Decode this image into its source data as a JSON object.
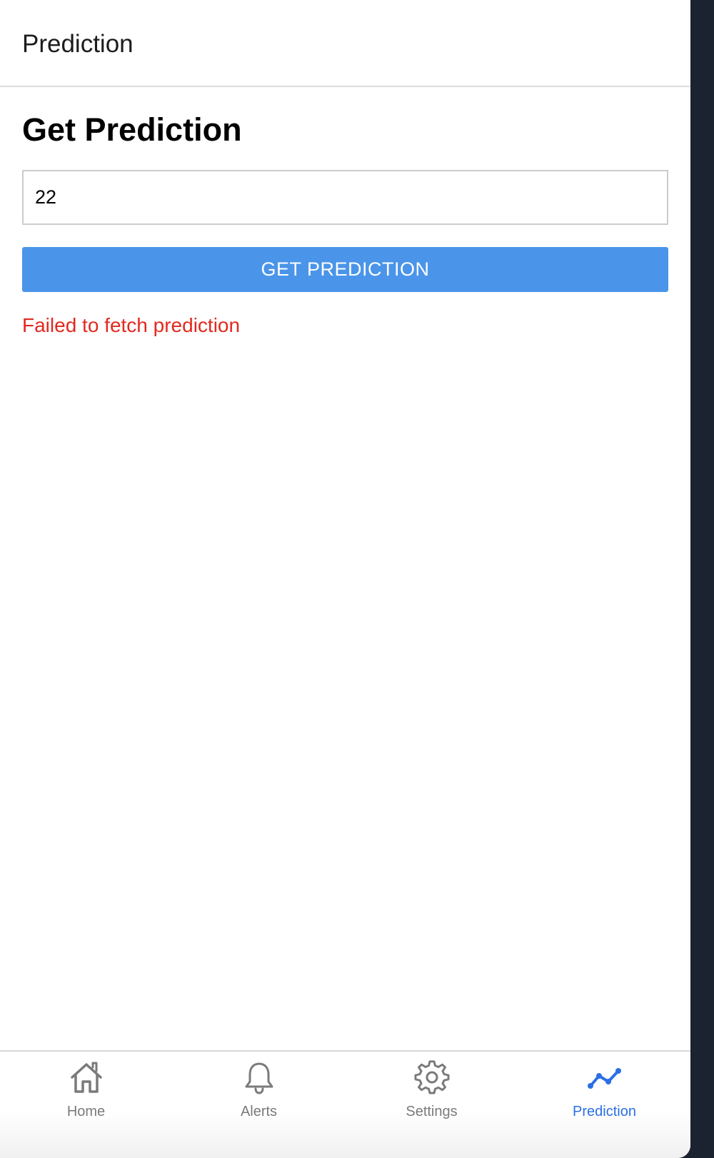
{
  "header": {
    "title": "Prediction"
  },
  "main": {
    "heading": "Get Prediction",
    "input_value": "22",
    "button_label": "GET PREDICTION",
    "error_message": "Failed to fetch prediction"
  },
  "tabbar": {
    "tabs": [
      {
        "label": "Home",
        "icon": "home-icon",
        "active": false
      },
      {
        "label": "Alerts",
        "icon": "bell-icon",
        "active": false
      },
      {
        "label": "Settings",
        "icon": "gear-icon",
        "active": false
      },
      {
        "label": "Prediction",
        "icon": "trend-line-icon",
        "active": true
      }
    ]
  },
  "colors": {
    "accent": "#4a95ea",
    "active_tab": "#2b6fe6",
    "inactive_tab": "#7a7a7a",
    "error": "#e2291f"
  }
}
